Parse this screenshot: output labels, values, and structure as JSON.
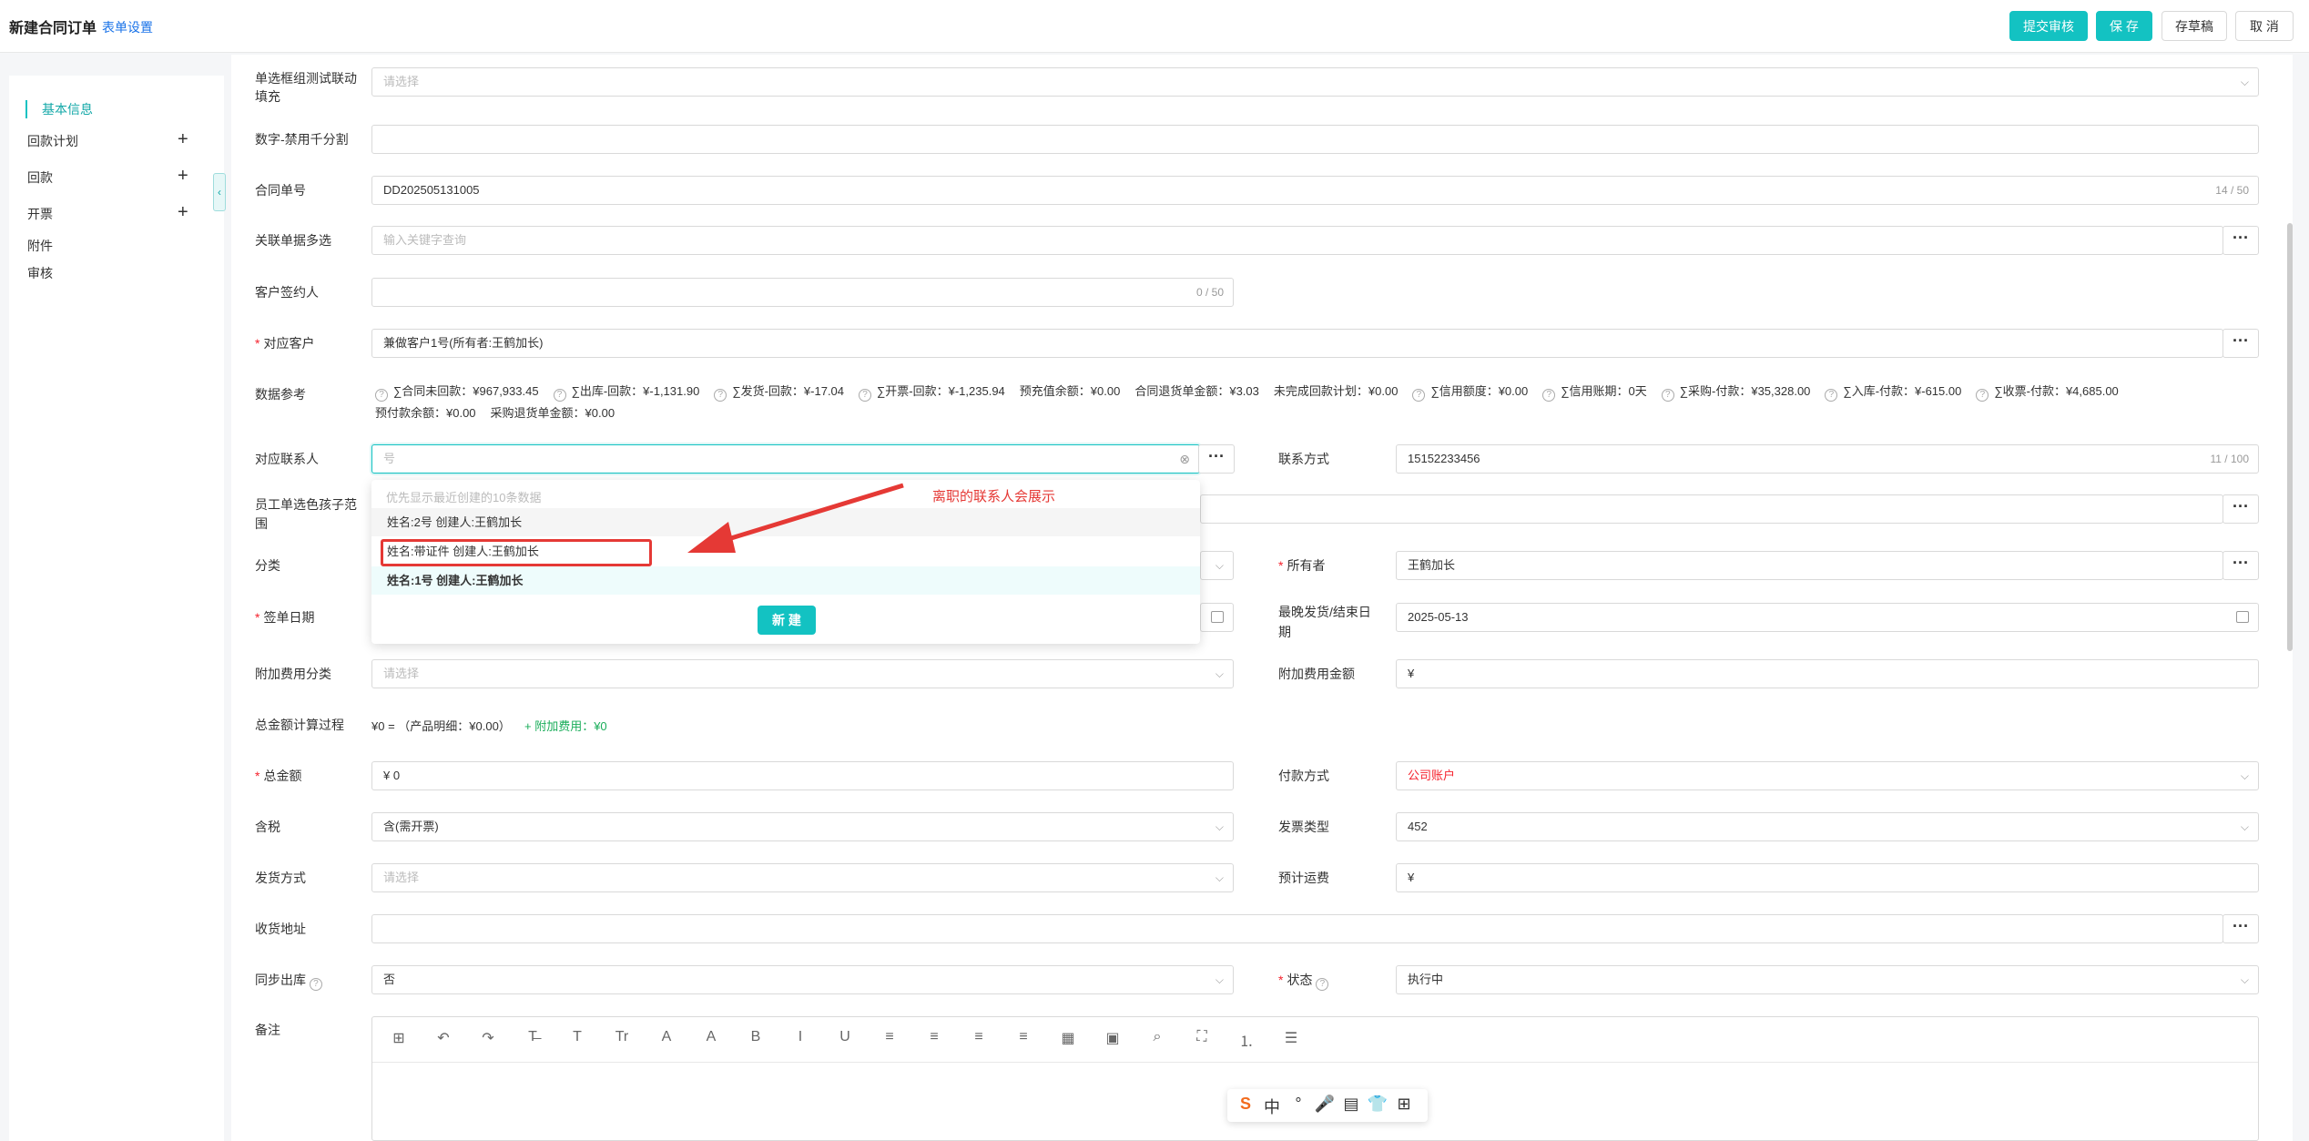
{
  "header": {
    "title": "新建合同订单",
    "form_setting": "表单设置",
    "submit_label": "提交审核",
    "save_label": "保 存",
    "draft_label": "存草稿",
    "cancel_label": "取 消"
  },
  "sidebar": {
    "items": [
      {
        "label": "基本信息",
        "active": true
      },
      {
        "label": "回款计划",
        "expandable": true
      },
      {
        "label": "回款",
        "expandable": true
      },
      {
        "label": "开票",
        "expandable": true
      },
      {
        "label": "附件"
      },
      {
        "label": "审核"
      }
    ],
    "plus_icon": "+",
    "collapse_icon": "‹"
  },
  "form": {
    "field0": {
      "label1": "单选框组测试联动",
      "label2": "填充",
      "placeholder": "请选择"
    },
    "number": {
      "label": "数字-禁用千分割",
      "value": ""
    },
    "contract_no": {
      "label": "合同单号",
      "value": "DD202505131005",
      "count": "14 / 50"
    },
    "related_docs": {
      "label": "关联单据多选",
      "placeholder": "输入关键字查询"
    },
    "signer": {
      "label": "客户签约人",
      "value": "",
      "count": "0 / 50"
    },
    "customer": {
      "label": "对应客户",
      "value": "兼做客户1号(所有者:王鹤加长)"
    },
    "data_ref": {
      "label": "数据参考",
      "row1": [
        "∑合同未回款：¥967,933.45",
        "∑出库-回款：¥-1,131.90",
        "∑发货-回款：¥-17.04",
        "∑开票-回款：¥-1,235.94",
        "预充值余额：¥0.00",
        "合同退货单金额：¥3.03",
        "未完成回款计划：¥0.00",
        "∑信用额度：¥0.00",
        "∑信用账期：0天",
        "∑采购-付款：¥35,328.00",
        "∑入库-付款：¥-615.00",
        "∑收票-付款：¥4,685.00"
      ],
      "row2": [
        "预付款余额：¥0.00",
        "采购退货单金额：¥0.00"
      ]
    },
    "contact": {
      "label": "对应联系人",
      "value": "号"
    },
    "contact_method": {
      "label": "联系方式",
      "value": "15152233456",
      "count": "11 / 100"
    },
    "employee_range": {
      "label1": "员工单选色孩子范",
      "label2": "围"
    },
    "category": {
      "label": "分类"
    },
    "owner": {
      "label": "所有者",
      "value": "王鹤加长"
    },
    "sign_date": {
      "label": "签单日期"
    },
    "last_ship": {
      "label1": "最晚发货/结束日",
      "label2": "期",
      "value": "2025-05-13"
    },
    "extra_fee_cat": {
      "label": "附加费用分类",
      "placeholder": "请选择"
    },
    "extra_fee_amt": {
      "label": "附加费用金额",
      "value": "¥"
    },
    "total_calc": {
      "label": "总金额计算过程",
      "text": "¥0 = （产品明细：¥0.00）",
      "extra": "+ 附加费用：¥0"
    },
    "total": {
      "label": "总金额",
      "value": "¥  0"
    },
    "payment": {
      "label": "付款方式",
      "value": "公司账户"
    },
    "tax": {
      "label": "含税",
      "value": "含(需开票)"
    },
    "invoice_type": {
      "label": "发票类型",
      "value": "452"
    },
    "ship_method": {
      "label": "发货方式",
      "placeholder": "请选择"
    },
    "freight": {
      "label": "预计运费",
      "value": "¥"
    },
    "address": {
      "label": "收货地址",
      "value": ""
    },
    "sync_out": {
      "label": "同步出库",
      "value": "否"
    },
    "status": {
      "label": "状态",
      "value": "执行中"
    },
    "remark": {
      "label": "备注"
    }
  },
  "dropdown": {
    "hint": "优先显示最近创建的10条数据",
    "options": [
      "姓名:2号 创建人:王鹤加长",
      "姓名:带证件 创建人:王鹤加长",
      "姓名:1号 创建人:王鹤加长"
    ],
    "new_label": "新 建"
  },
  "annotation": {
    "text": "离职的联系人会展示",
    "color": "#e53935"
  },
  "editor_toolbar": [
    "⊞",
    "↶",
    "↷",
    "T̶",
    "T",
    "Tr",
    "A",
    "A",
    "B",
    "I",
    "U",
    "≡",
    "≡",
    "≡",
    "≡",
    "▦",
    "▣",
    "⌕",
    "⛶",
    "⒈",
    "☰"
  ],
  "ime_bar": [
    "S",
    "中",
    "°",
    "🎤",
    "▤",
    "👕",
    "⊞"
  ],
  "colors": {
    "accent": "#13c2c2",
    "danger": "#f5222d",
    "link": "#1a73e8"
  }
}
